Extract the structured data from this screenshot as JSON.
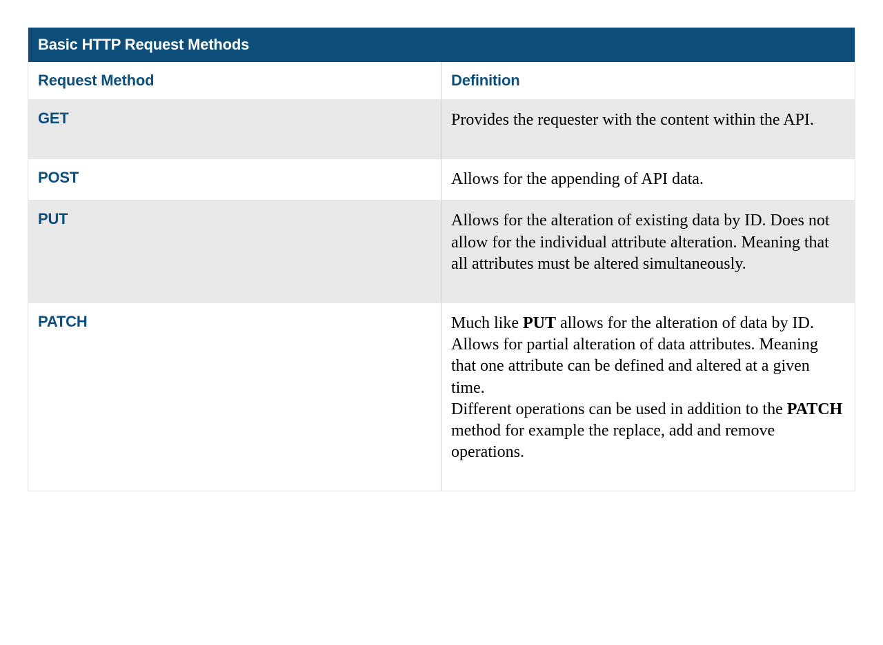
{
  "title": "Basic HTTP Request Methods",
  "columns": {
    "method": "Request Method",
    "definition": "Definition"
  },
  "rows": [
    {
      "method": "GET",
      "definition_html": " Provides the requester with the content within the API.",
      "alt": true,
      "short": false
    },
    {
      "method": "POST",
      "definition_html": "Allows for the appending of API data.",
      "alt": false,
      "short": true
    },
    {
      "method": "PUT",
      "definition_html": "Allows for the alteration of existing data by ID.  Does not allow for the individual attribute alteration.  Meaning that all attributes must be altered simultaneously.",
      "alt": true,
      "short": false
    },
    {
      "method": "PATCH",
      "definition_html": "<p>Much like <strong>PUT</strong> allows for the alteration of data by ID. Allows for partial alteration of data attributes. Meaning that one attribute can be defined and altered at a given time.</p><p class=\"para2\">Different operations can be used in addition to the <strong>PATCH</strong> method for example the replace, add and remove operations.</p>",
      "alt": false,
      "short": false
    }
  ],
  "chart_data": {
    "type": "table",
    "title": "Basic HTTP Request Methods",
    "columns": [
      "Request Method",
      "Definition"
    ],
    "rows": [
      [
        "GET",
        "Provides the requester with the content within the API."
      ],
      [
        "POST",
        "Allows for the appending of API data."
      ],
      [
        "PUT",
        "Allows for the alteration of existing data by ID. Does not allow for the individual attribute alteration. Meaning that all attributes must be altered simultaneously."
      ],
      [
        "PATCH",
        "Much like PUT allows for the alteration of data by ID. Allows for partial alteration of data attributes. Meaning that one attribute can be defined and altered at a given time. Different operations can be used in addition to the PATCH method for example the replace, add and remove operations."
      ]
    ]
  }
}
